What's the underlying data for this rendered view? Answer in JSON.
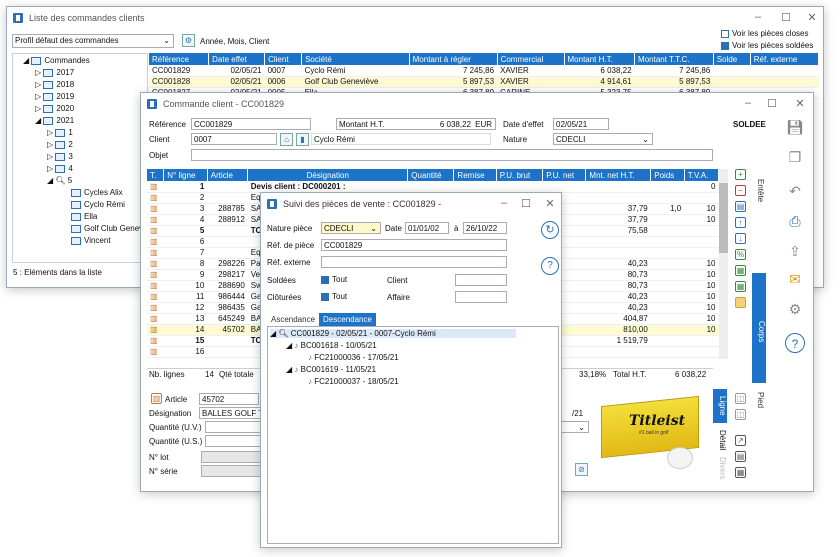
{
  "win1": {
    "title": "Liste des commandes clients",
    "profile": "Profil défaut des commandes",
    "grouping": "Année, Mois, Client",
    "chk_closed": "Voir les pièces closes",
    "chk_paid": "Voir les pièces soldées",
    "status": "5 : Eléments dans la liste",
    "tree": {
      "root": "Commandes",
      "years": [
        "2017",
        "2018",
        "2019",
        "2020",
        "2021"
      ],
      "months": [
        "1",
        "2",
        "3",
        "4",
        "5"
      ],
      "clients": [
        "Cycles Alix",
        "Cyclo Rémi",
        "Ella",
        "Golf Club Genev",
        "Vincent"
      ]
    },
    "columns": [
      "Référence",
      "Date effet",
      "Client",
      "Société",
      "Montant à régler",
      "Commercial",
      "Montant H.T.",
      "Montant T.T.C.",
      "Solde",
      "Réf. externe"
    ],
    "rows": [
      [
        "CC001829",
        "02/05/21",
        "0007",
        "Cyclo Rémi",
        "7 245,86",
        "XAVIER",
        "6 038,22",
        "7 245,86"
      ],
      [
        "CC001828",
        "02/05/21",
        "0006",
        "Golf Club Geneviève",
        "5 897,53",
        "XAVIER",
        "4 914,61",
        "5 897,53"
      ],
      [
        "CC001827",
        "02/05/21",
        "0005",
        "Ella",
        "6 387,89",
        "CARINE",
        "5 323,75",
        "6 387,89"
      ]
    ]
  },
  "win2": {
    "title": "Commande client - CC001829",
    "ref_label": "Référence",
    "ref": "CC001829",
    "mht_label": "Montant H.T.",
    "mht": "6 038,22",
    "currency": "EUR",
    "date_label": "Date d'effet",
    "date": "02/05/21",
    "soldee": "SOLDEE",
    "client_label": "Client",
    "client_code": "0007",
    "client_name": "Cyclo Rémi",
    "nature_label": "Nature",
    "nature": "CDECLI",
    "objet_label": "Objet",
    "columns": [
      "T.",
      "N° ligne",
      "Article",
      "Désignation",
      "Quantité",
      "Remise",
      "P.U. brut",
      "P.U. net",
      "Mnt. net H.T.",
      "Poids",
      "T.V.A."
    ],
    "rows": [
      [
        "1",
        "",
        "Devis client : DC000201 :",
        "",
        "",
        "",
        "",
        "",
        "",
        "0"
      ],
      [
        "2",
        "",
        "Equip",
        "",
        "",
        "",
        "",
        "",
        "",
        ""
      ],
      [
        "3",
        "288785",
        "SAC G",
        "",
        "",
        "",
        "",
        "37,79",
        "1,0",
        "10"
      ],
      [
        "4",
        "288912",
        "SAC G",
        "",
        "",
        "",
        "",
        "37,79",
        "",
        "10"
      ],
      [
        "5",
        "",
        "TOTAL",
        "",
        "",
        "",
        "",
        "75,58",
        "",
        ""
      ],
      [
        "6",
        "",
        "",
        "",
        "",
        "",
        "",
        "",
        "",
        ""
      ],
      [
        "7",
        "",
        "Equip",
        "",
        "",
        "",
        "",
        "",
        "",
        ""
      ],
      [
        "8",
        "298226",
        "Panta",
        "",
        "",
        "",
        "",
        "40,23",
        "",
        "10"
      ],
      [
        "9",
        "298217",
        "Veste",
        "",
        "",
        "",
        "",
        "80,73",
        "",
        "10"
      ],
      [
        "10",
        "288690",
        "Sweat",
        "",
        "",
        "",
        "",
        "80,73",
        "",
        "10"
      ],
      [
        "11",
        "986444",
        "Gants",
        "",
        "",
        "",
        "",
        "40,23",
        "",
        "10"
      ],
      [
        "12",
        "986435",
        "Gants",
        "",
        "",
        "",
        "",
        "40,23",
        "",
        "10"
      ],
      [
        "13",
        "645249",
        "BALLE",
        "",
        "",
        "",
        "",
        "404,87",
        "",
        "10"
      ],
      [
        "14",
        "45702",
        "BALLE",
        "",
        "",
        "",
        "",
        "810,00",
        "",
        "10"
      ],
      [
        "15",
        "",
        "TOTAL",
        "",
        "",
        "",
        "",
        "1 519,79",
        "",
        ""
      ],
      [
        "16",
        "",
        "",
        "",
        "",
        "",
        "",
        "",
        "",
        ""
      ]
    ],
    "nb_lines_label": "Nb. lignes",
    "nb_lines": "14",
    "qte_label": "Qté totale",
    "pct": "33,18%",
    "total_label": "Total H.T.",
    "total": "6 038,22",
    "article_label": "Article",
    "article": "45702",
    "design_label": "Désignation",
    "design": "BALLES GOLF TITL",
    "quv_label": "Quantité (U.V.)",
    "qus_label": "Quantité (U.S.)",
    "lot_label": "N° lot",
    "serie_label": "N° série",
    "date2": "/21",
    "tabs_right": [
      "Entête",
      "Corps",
      "Pied"
    ],
    "tabs_ligne": [
      "Ligne",
      "Détail",
      "Divers"
    ],
    "ball_brand": "Titleist",
    "ball_tag": "#1 ball in golf"
  },
  "win3": {
    "title": "Suivi des pièces de vente : CC001829 -",
    "nature_label": "Nature pièce",
    "nature": "CDECLI",
    "date_label": "Date",
    "date_from": "01/01/02",
    "to_label": "à",
    "date_to": "26/10/22",
    "ref_label": "Réf. de pièce",
    "ref": "CC001829",
    "ext_label": "Réf. externe",
    "soldees_label": "Soldées",
    "tout": "Tout",
    "client_label": "Client",
    "closed_label": "Clôturées",
    "affaire_label": "Affaire",
    "tab_asc": "Ascendance",
    "tab_desc": "Descendance",
    "tree": [
      "CC001829 - 02/05/21 - 0007-Cyclo Rémi",
      "BC001618 - 10/05/21",
      "FC21000036 - 17/05/21",
      "BC001619 - 11/05/21",
      "FC21000037 - 18/05/21"
    ]
  }
}
